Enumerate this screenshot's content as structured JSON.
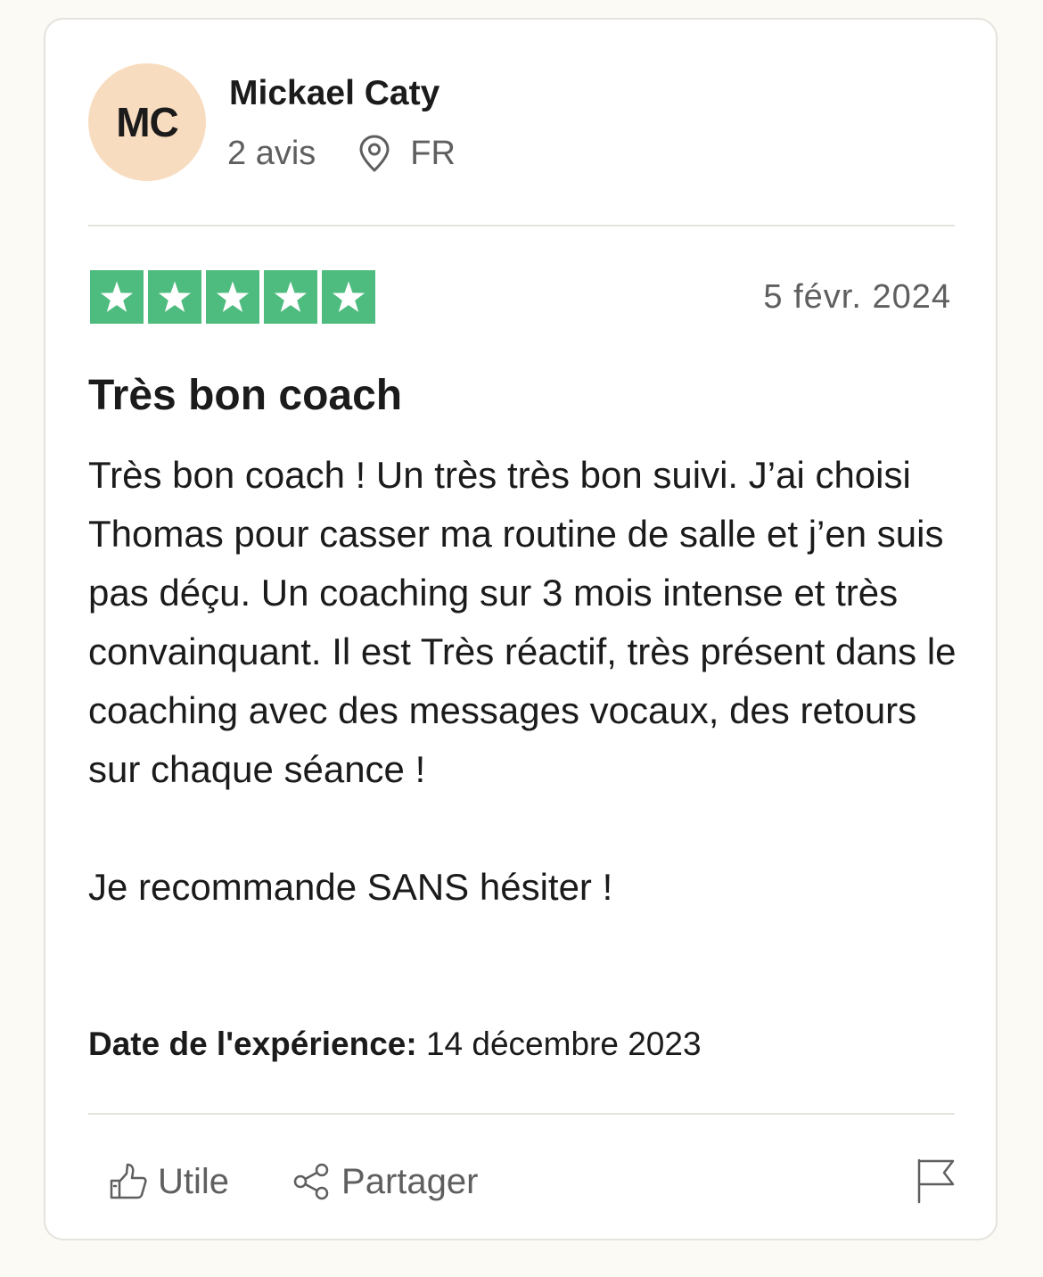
{
  "user": {
    "initials": "MC",
    "name": "Mickael Caty",
    "reviews_count": "2 avis",
    "country": "FR",
    "avatar_color": "#f8dcbf"
  },
  "review": {
    "rating": 5,
    "rating_max": 5,
    "star_color": "#4fbc7f",
    "date": "5 févr. 2024",
    "title": "Très bon coach",
    "body_paragraph_1": "Très bon coach ! Un très très bon suivi. J’ai choisi Thomas pour casser ma routine de salle et j’en suis pas déçu. Un coaching sur 3 mois intense et très convainquant. Il est Très réactif, très présent dans le coaching avec des messages vocaux, des retours sur chaque séance !",
    "body_paragraph_2": "Je recommande SANS hésiter !",
    "experience_label": "Date de l'expérience:",
    "experience_date": "14 décembre 2023"
  },
  "actions": {
    "useful_label": "Utile",
    "share_label": "Partager",
    "useful_icon": "thumbs-up-icon",
    "share_icon": "share-icon",
    "report_icon": "flag-icon"
  }
}
